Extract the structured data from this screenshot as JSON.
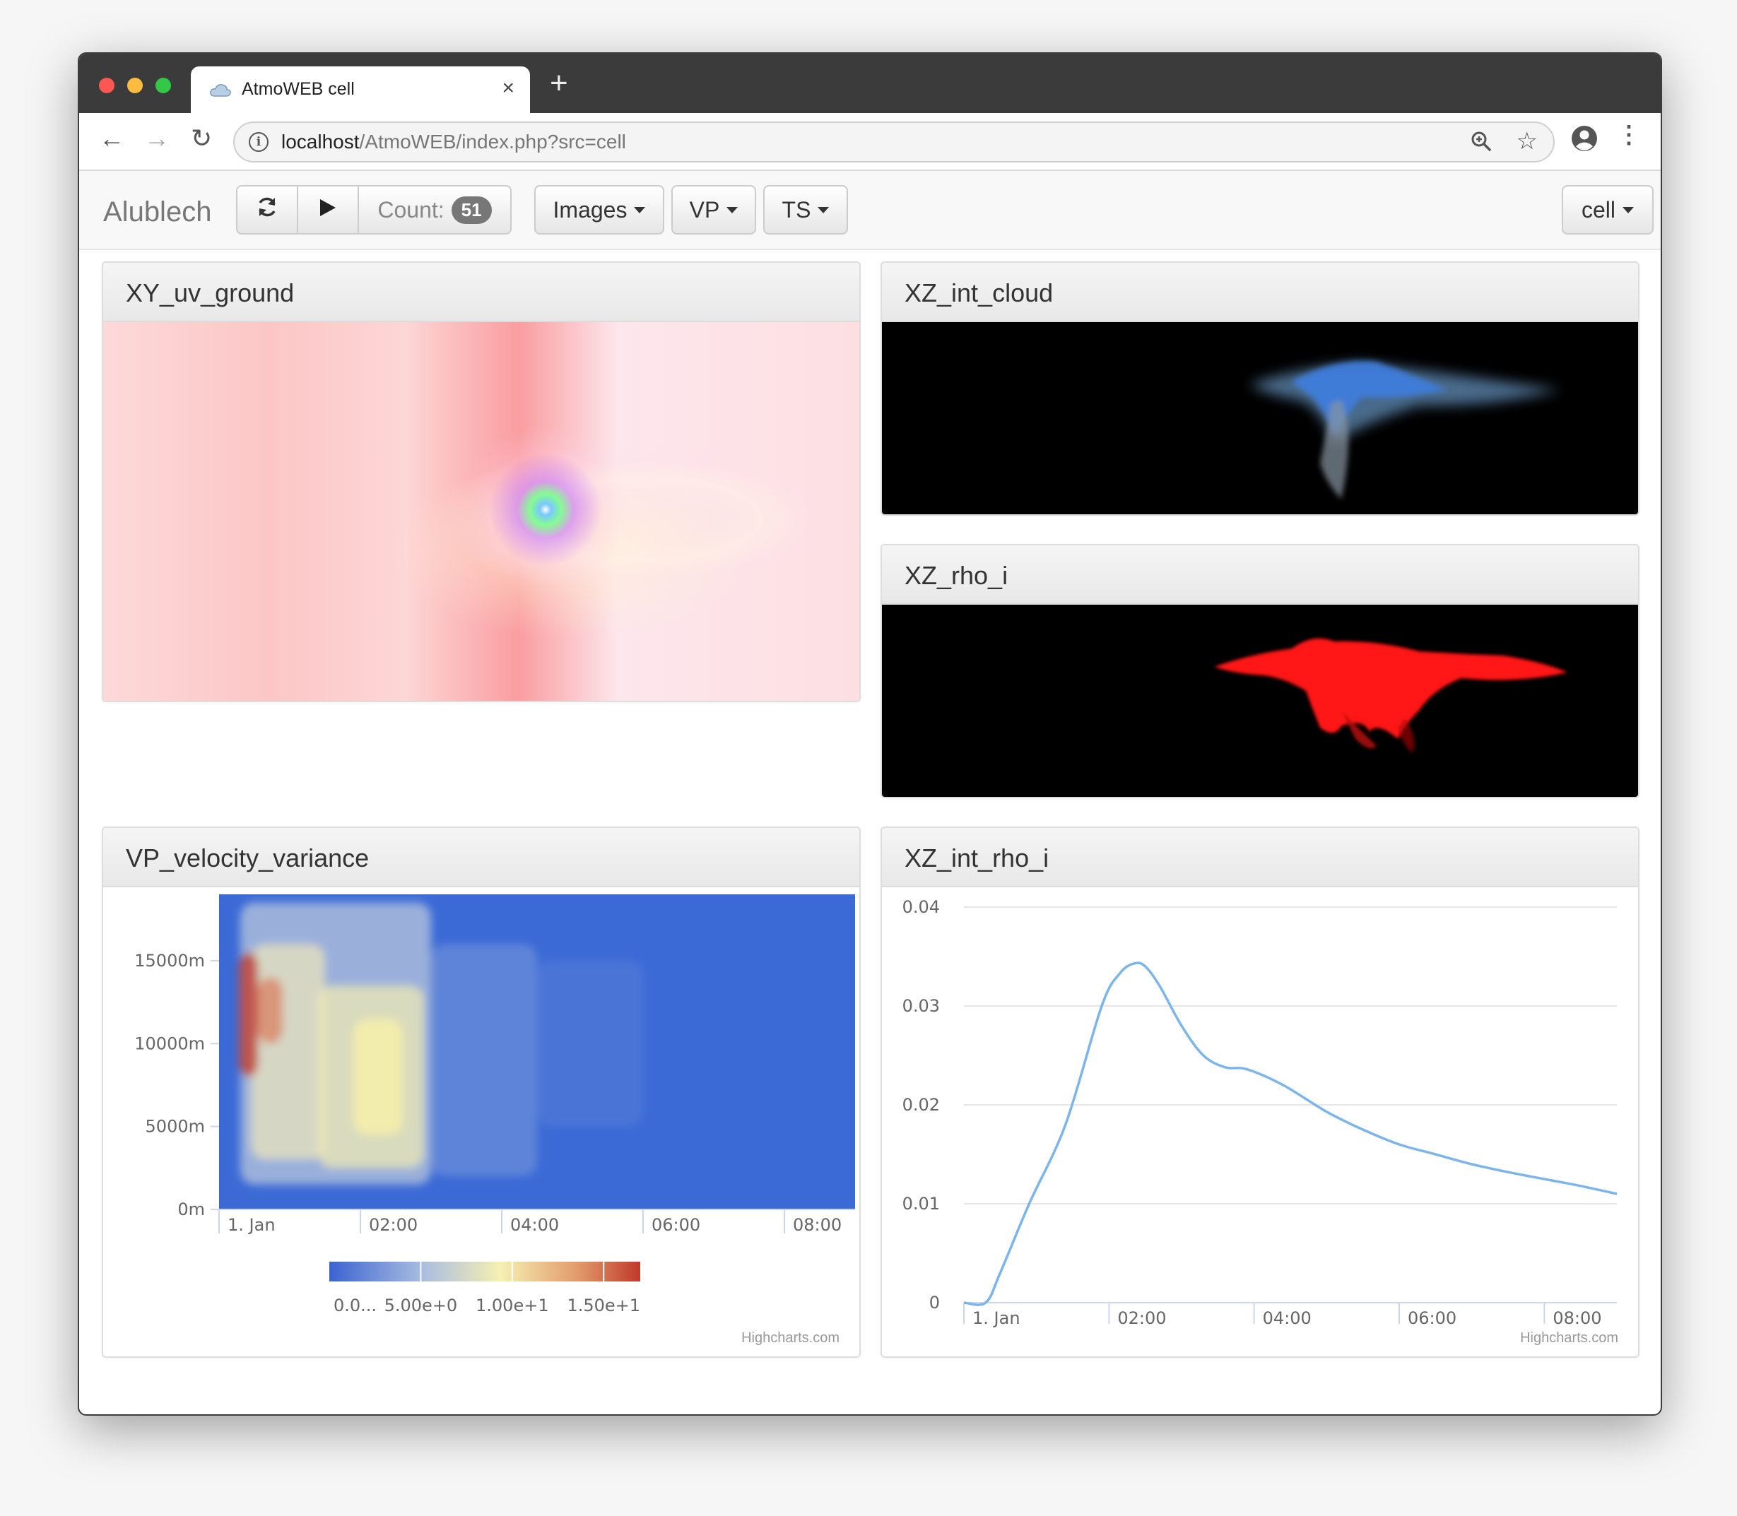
{
  "browser": {
    "tab_title": "AtmoWEB cell",
    "tab_close": "×",
    "new_tab": "+",
    "url_host": "localhost",
    "url_path": "/AtmoWEB/index.php?src=cell",
    "back": "←",
    "forward": "→",
    "reload": "↻",
    "menu": "⋮",
    "star": "☆"
  },
  "navbar": {
    "brand": "Alublech",
    "count_label": "Count:",
    "count_value": "51",
    "images_label": "Images",
    "vp_label": "VP",
    "ts_label": "TS",
    "cell_label": "cell"
  },
  "panels": {
    "xy_uv_ground": "XY_uv_ground",
    "xz_int_cloud": "XZ_int_cloud",
    "xz_rho_i": "XZ_rho_i",
    "vp_velocity_variance": "VP_velocity_variance",
    "xz_int_rho_i": "XZ_int_rho_i"
  },
  "credit": "Highcharts.com",
  "chart_data": [
    {
      "type": "heatmap",
      "y_tick_labels": [
        "15000m",
        "10000m",
        "5000m",
        "0m"
      ],
      "y_tick_values": [
        15000,
        10000,
        5000,
        0
      ],
      "ylim": [
        0,
        19000
      ],
      "x_tick_labels": [
        "1. Jan",
        "02:00",
        "04:00",
        "06:00",
        "08:00"
      ],
      "x_tick_hours": [
        0,
        2,
        4,
        6,
        8
      ],
      "xlim_hours": [
        0,
        9
      ],
      "colorbar_labels": [
        "0.0...",
        "5.00e+0",
        "1.00e+1",
        "1.50e+1"
      ],
      "colorbar_range": [
        0,
        17
      ],
      "colors": {
        "low": "#3b6ad6",
        "mid": "#f5efb0",
        "high": "#c0392b"
      }
    },
    {
      "type": "line",
      "y_tick_labels": [
        "0.04",
        "0.03",
        "0.02",
        "0.01",
        "0"
      ],
      "y_tick_values": [
        0.04,
        0.03,
        0.02,
        0.01,
        0
      ],
      "ylim": [
        0,
        0.04
      ],
      "x_tick_labels": [
        "1. Jan",
        "02:00",
        "04:00",
        "06:00",
        "08:00"
      ],
      "x_tick_hours": [
        0,
        2,
        4,
        6,
        8
      ],
      "xlim_hours": [
        0,
        9
      ],
      "grid": true,
      "color": "#7cb5ec",
      "x": [
        0,
        0.3,
        0.5,
        0.9,
        1.4,
        1.9,
        2.15,
        2.35,
        2.5,
        2.7,
        3.0,
        3.3,
        3.6,
        3.9,
        4.4,
        5.0,
        5.5,
        6.0,
        6.5,
        7.0,
        7.5,
        8.0,
        8.5,
        9.0
      ],
      "y": [
        0,
        0,
        0.003,
        0.01,
        0.018,
        0.03,
        0.0333,
        0.0343,
        0.034,
        0.032,
        0.028,
        0.025,
        0.0238,
        0.0236,
        0.022,
        0.0193,
        0.0175,
        0.016,
        0.015,
        0.014,
        0.0132,
        0.0125,
        0.0118,
        0.011
      ]
    }
  ]
}
